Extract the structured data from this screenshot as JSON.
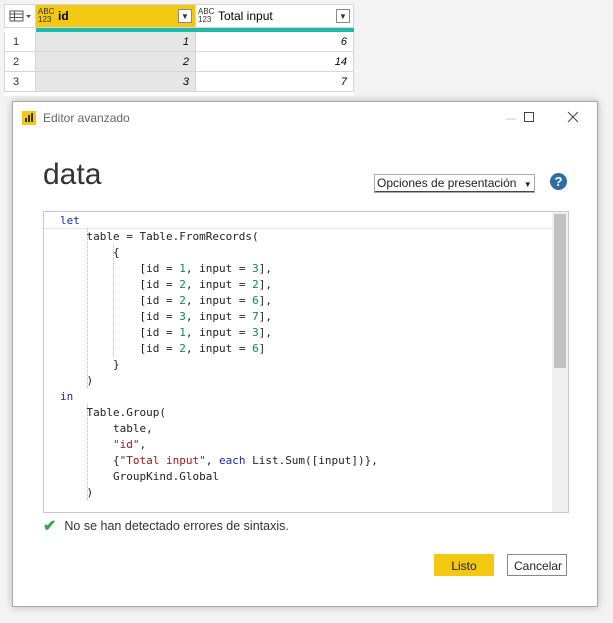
{
  "grid": {
    "columns": [
      {
        "type_label_top": "ABC",
        "type_label_bottom": "123",
        "name": "id"
      },
      {
        "type_label_top": "ABC",
        "type_label_bottom": "123",
        "name": "Total input"
      }
    ],
    "rows": [
      {
        "index": "1",
        "id": "1",
        "total": "6"
      },
      {
        "index": "2",
        "id": "2",
        "total": "14"
      },
      {
        "index": "3",
        "id": "3",
        "total": "7"
      }
    ]
  },
  "dialog": {
    "window_title": "Editor avanzado",
    "query_name": "data",
    "view_options_label": "Opciones de presentación",
    "status_text": "No se han detectado errores de sintaxis.",
    "done_label": "Listo",
    "cancel_label": "Cancelar"
  },
  "code_lines": [
    "let",
    "    table = Table.FromRecords(",
    "        {",
    "            [id = 1, input = 3],",
    "            [id = 2, input = 2],",
    "            [id = 2, input = 6],",
    "            [id = 3, input = 7],",
    "            [id = 1, input = 3],",
    "            [id = 2, input = 6]",
    "        }",
    "    )",
    "in",
    "    Table.Group(",
    "        table,",
    "        \"id\",",
    "        {\"Total input\", each List.Sum([input])},",
    "        GroupKind.Global",
    "    )"
  ],
  "colors": {
    "accent": "#f2c811",
    "teal_bar": "#1db8a8",
    "keyword": "#1a2d9c",
    "number": "#09885a",
    "string": "#a31515",
    "success": "#3aa64d"
  }
}
